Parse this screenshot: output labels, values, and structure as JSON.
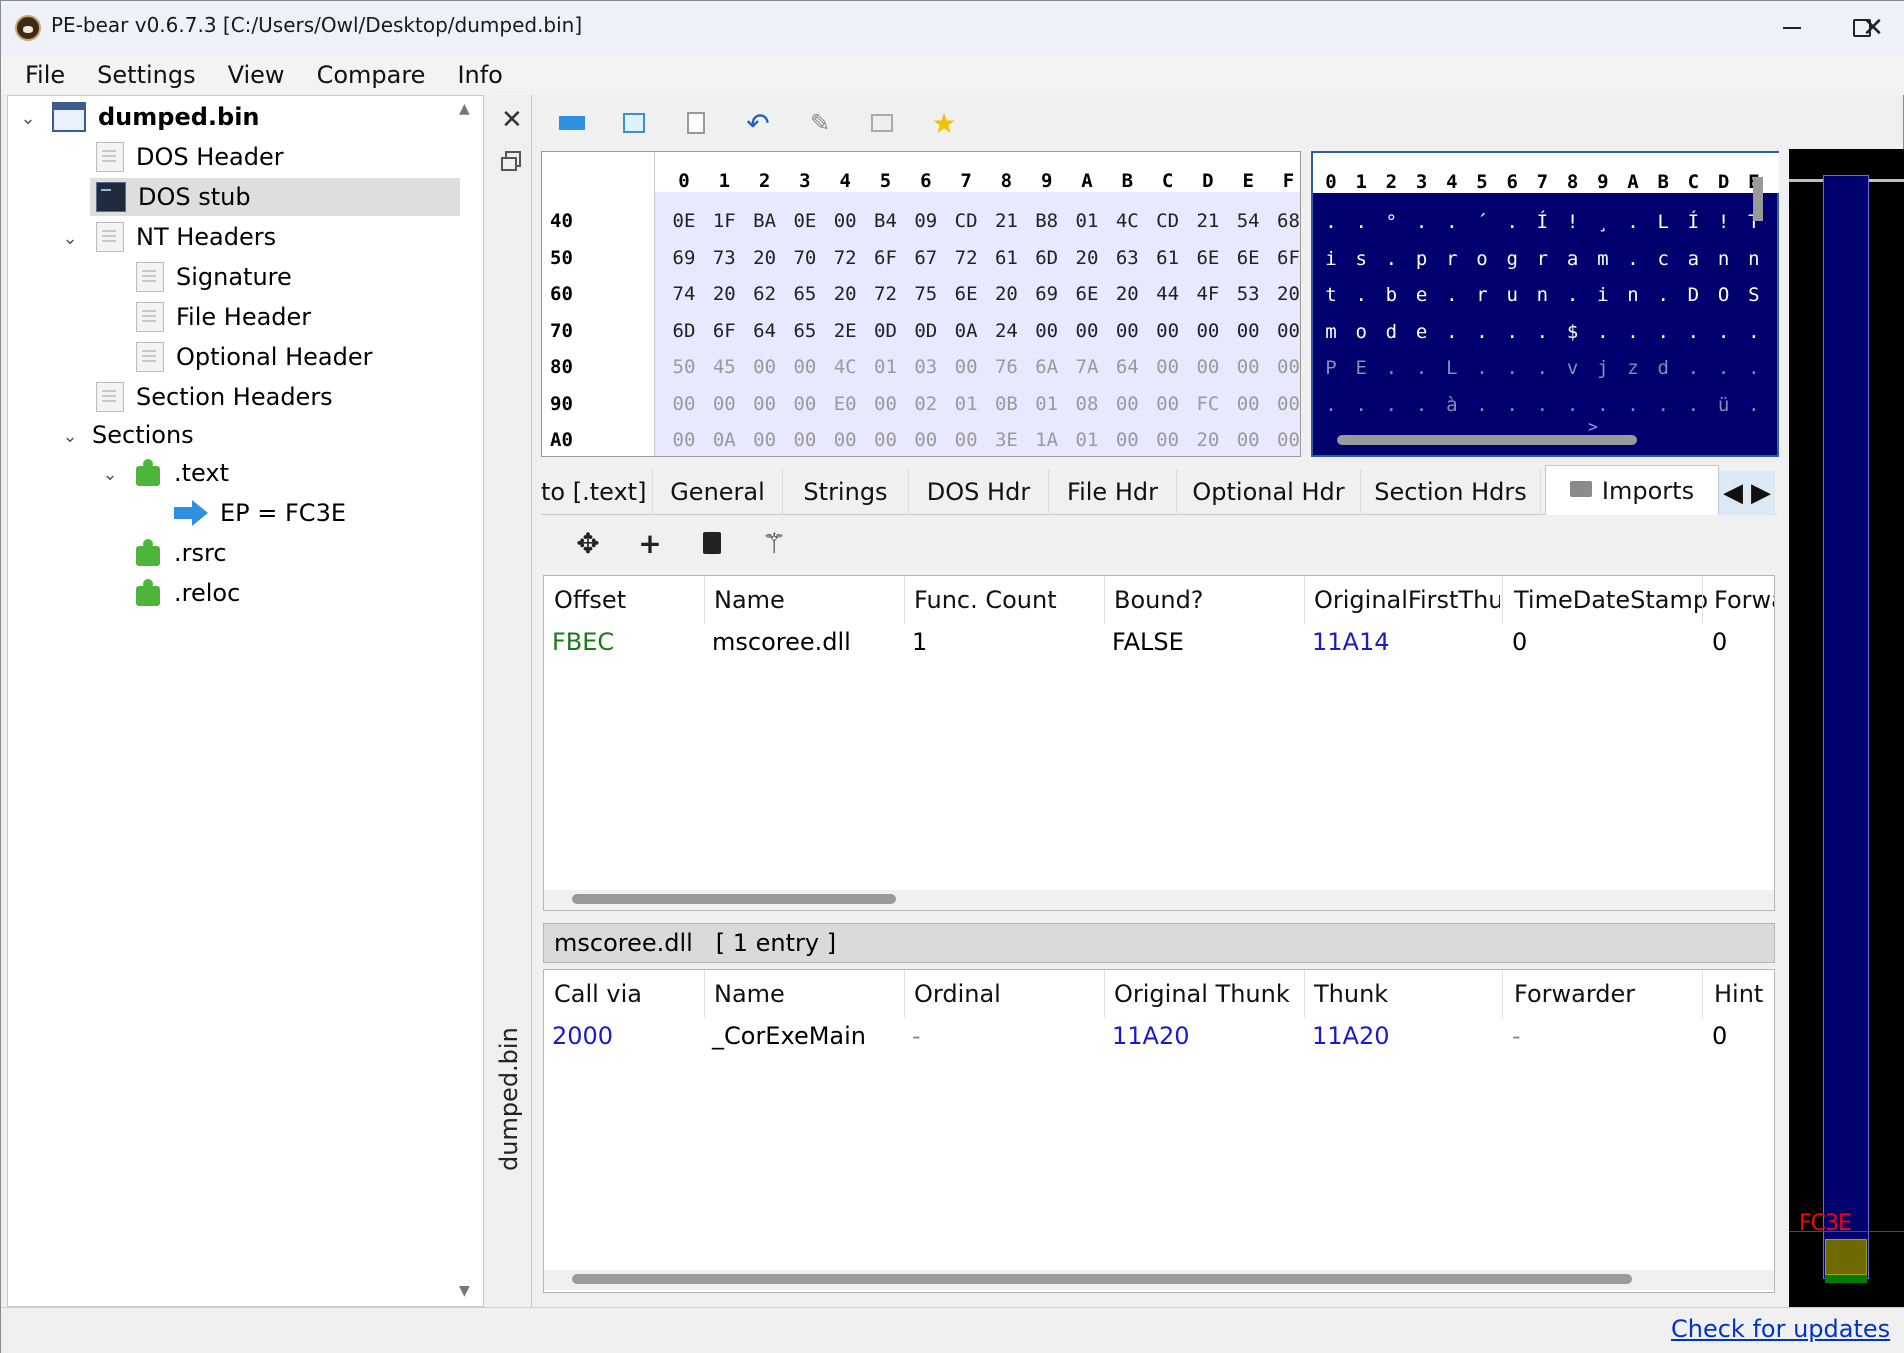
{
  "window": {
    "title": "PE-bear v0.6.7.3 [C:/Users/Owl/Desktop/dumped.bin]",
    "controls": [
      "—",
      "☐",
      "✕"
    ]
  },
  "menu": [
    "File",
    "Settings",
    "View",
    "Compare",
    "Info"
  ],
  "tree": {
    "root": "dumped.bin",
    "items": [
      {
        "label": "DOS Header",
        "icon": "doc-icon"
      },
      {
        "label": "DOS stub",
        "icon": "stub-icon",
        "selected": true
      },
      {
        "label": "NT Headers",
        "icon": "doc-icon",
        "expanded": true
      },
      {
        "label": "Signature",
        "icon": "doc-icon"
      },
      {
        "label": "File Header",
        "icon": "doc-icon"
      },
      {
        "label": "Optional Header",
        "icon": "doc-icon"
      },
      {
        "label": "Section Headers",
        "icon": "doc-icon"
      },
      {
        "label": "Sections",
        "expanded": true
      },
      {
        "label": ".text",
        "icon": "puzzle-icon",
        "expanded": true
      },
      {
        "label": "EP = FC3E",
        "icon": "ep-arrow-icon"
      },
      {
        "label": ".rsrc",
        "icon": "puzzle-icon"
      },
      {
        "label": ".reloc",
        "icon": "puzzle-icon"
      }
    ]
  },
  "vertical_tab": {
    "label": "dumped.bin"
  },
  "toolbar_icons": [
    "goto-arrow-icon",
    "goto-rva-icon",
    "export-icon",
    "undo-icon",
    "pin-icon",
    "compare-icon",
    "star-icon"
  ],
  "hex": {
    "columns": [
      "0",
      "1",
      "2",
      "3",
      "4",
      "5",
      "6",
      "7",
      "8",
      "9",
      "A",
      "B",
      "C",
      "D",
      "E",
      "F"
    ],
    "rows": [
      {
        "addr": "40",
        "bytes": [
          "0E",
          "1F",
          "BA",
          "0E",
          "00",
          "B4",
          "09",
          "CD",
          "21",
          "B8",
          "01",
          "4C",
          "CD",
          "21",
          "54",
          "68"
        ],
        "ascii": [
          ".",
          ".",
          "°",
          ".",
          ".",
          "´",
          ".",
          "Í",
          "!",
          "¸",
          ".",
          "L",
          "Í",
          "!",
          "T"
        ]
      },
      {
        "addr": "50",
        "bytes": [
          "69",
          "73",
          "20",
          "70",
          "72",
          "6F",
          "67",
          "72",
          "61",
          "6D",
          "20",
          "63",
          "61",
          "6E",
          "6E",
          "6F"
        ],
        "ascii": [
          "i",
          "s",
          ".",
          "p",
          "r",
          "o",
          "g",
          "r",
          "a",
          "m",
          ".",
          "c",
          "a",
          "n",
          "n"
        ]
      },
      {
        "addr": "60",
        "bytes": [
          "74",
          "20",
          "62",
          "65",
          "20",
          "72",
          "75",
          "6E",
          "20",
          "69",
          "6E",
          "20",
          "44",
          "4F",
          "53",
          "20"
        ],
        "ascii": [
          "t",
          ".",
          "b",
          "e",
          ".",
          "r",
          "u",
          "n",
          ".",
          "i",
          "n",
          ".",
          "D",
          "O",
          "S"
        ]
      },
      {
        "addr": "70",
        "bytes": [
          "6D",
          "6F",
          "64",
          "65",
          "2E",
          "0D",
          "0D",
          "0A",
          "24",
          "00",
          "00",
          "00",
          "00",
          "00",
          "00",
          "00"
        ],
        "ascii": [
          "m",
          "o",
          "d",
          "e",
          ".",
          ".",
          ".",
          ".",
          "$",
          ".",
          ".",
          ".",
          ".",
          ".",
          "."
        ]
      },
      {
        "addr": "80",
        "bytes": [
          "50",
          "45",
          "00",
          "00",
          "4C",
          "01",
          "03",
          "00",
          "76",
          "6A",
          "7A",
          "64",
          "00",
          "00",
          "00",
          "00"
        ],
        "ascii": [
          "P",
          "E",
          ".",
          ".",
          "L",
          ".",
          ".",
          ".",
          "v",
          "j",
          "z",
          "d",
          ".",
          ".",
          "."
        ]
      },
      {
        "addr": "90",
        "bytes": [
          "00",
          "00",
          "00",
          "00",
          "E0",
          "00",
          "02",
          "01",
          "0B",
          "01",
          "08",
          "00",
          "00",
          "FC",
          "00",
          "00"
        ],
        "ascii": [
          ".",
          ".",
          ".",
          ".",
          "à",
          ".",
          ".",
          ".",
          ".",
          ".",
          ".",
          ".",
          ".",
          "ü",
          "."
        ]
      },
      {
        "addr": "A0",
        "bytes": [
          "00",
          "0A",
          "00",
          "00",
          "00",
          "00",
          "00",
          "00",
          "3E",
          "1A",
          "01",
          "00",
          "00",
          "20",
          "00",
          "00"
        ],
        "ascii": []
      }
    ],
    "ascii_columns": [
      "0",
      "1",
      "2",
      "3",
      "4",
      "5",
      "6",
      "7",
      "8",
      "9",
      "A",
      "B",
      "C",
      "D",
      "E"
    ],
    "ascii_overflow": ">"
  },
  "tabs": [
    {
      "label": "to [.text]"
    },
    {
      "label": "General"
    },
    {
      "label": "Strings"
    },
    {
      "label": "DOS Hdr"
    },
    {
      "label": "File Hdr"
    },
    {
      "label": "Optional Hdr"
    },
    {
      "label": "Section Hdrs"
    },
    {
      "label": "Imports",
      "active": true
    }
  ],
  "imports_toolbar": [
    "move-icon",
    "add-icon",
    "save-icon",
    "wand-icon"
  ],
  "imports_table": {
    "headers": [
      "Offset",
      "Name",
      "Func. Count",
      "Bound?",
      "OriginalFirstThunl",
      "TimeDateStamp",
      "Forwa"
    ],
    "rows": [
      {
        "offset": "FBEC",
        "name": "mscoree.dll",
        "func_count": "1",
        "bound": "FALSE",
        "oft": "11A14",
        "tds": "0",
        "fwd": "0"
      }
    ]
  },
  "subheader": "mscoree.dll   [ 1 entry ]",
  "functions_table": {
    "headers": [
      "Call via",
      "Name",
      "Ordinal",
      "Original Thunk",
      "Thunk",
      "Forwarder",
      "Hint"
    ],
    "rows": [
      {
        "call_via": "2000",
        "name": "_CorExeMain",
        "ordinal": "-",
        "orig_thunk": "11A20",
        "thunk": "11A20",
        "forwarder": "-",
        "hint": "0"
      }
    ]
  },
  "overview": {
    "ep_label": "FC3E"
  },
  "status": {
    "link": "Check for updates"
  }
}
